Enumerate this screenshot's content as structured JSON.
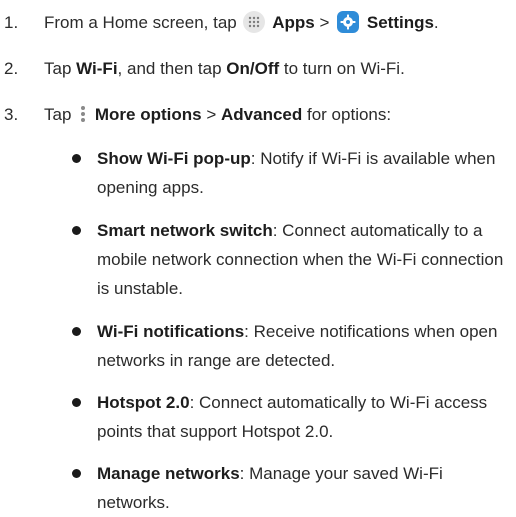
{
  "steps": [
    {
      "num": "1.",
      "pre": "From a Home screen, tap",
      "apps": "Apps",
      "sep": ">",
      "settings": "Settings",
      "post": "."
    },
    {
      "num": "2.",
      "pre": "Tap",
      "wifi": "Wi-Fi",
      "mid": ", and then tap",
      "onoff": "On/Off",
      "post": "to turn on Wi-Fi."
    },
    {
      "num": "3.",
      "pre": "Tap",
      "more": "More options",
      "sep": ">",
      "advanced": "Advanced",
      "post": "for options:"
    }
  ],
  "options": [
    {
      "title": "Show Wi-Fi pop-up",
      "desc": ": Notify if Wi-Fi is available when opening apps."
    },
    {
      "title": "Smart network switch",
      "desc": ": Connect automatically to a mobile network connection when the Wi-Fi connection is unstable."
    },
    {
      "title": "Wi-Fi notifications",
      "desc": ": Receive notifications when open networks in range are detected."
    },
    {
      "title": "Hotspot 2.0",
      "desc": ": Connect automatically to Wi-Fi access points that support Hotspot 2.0."
    },
    {
      "title": "Manage networks",
      "desc": ": Manage your saved Wi-Fi networks."
    }
  ],
  "icons": {
    "apps": "apps-grid-icon",
    "settings": "gear-icon",
    "more": "more-options-icon",
    "settings_color": "#2f8cd8"
  }
}
